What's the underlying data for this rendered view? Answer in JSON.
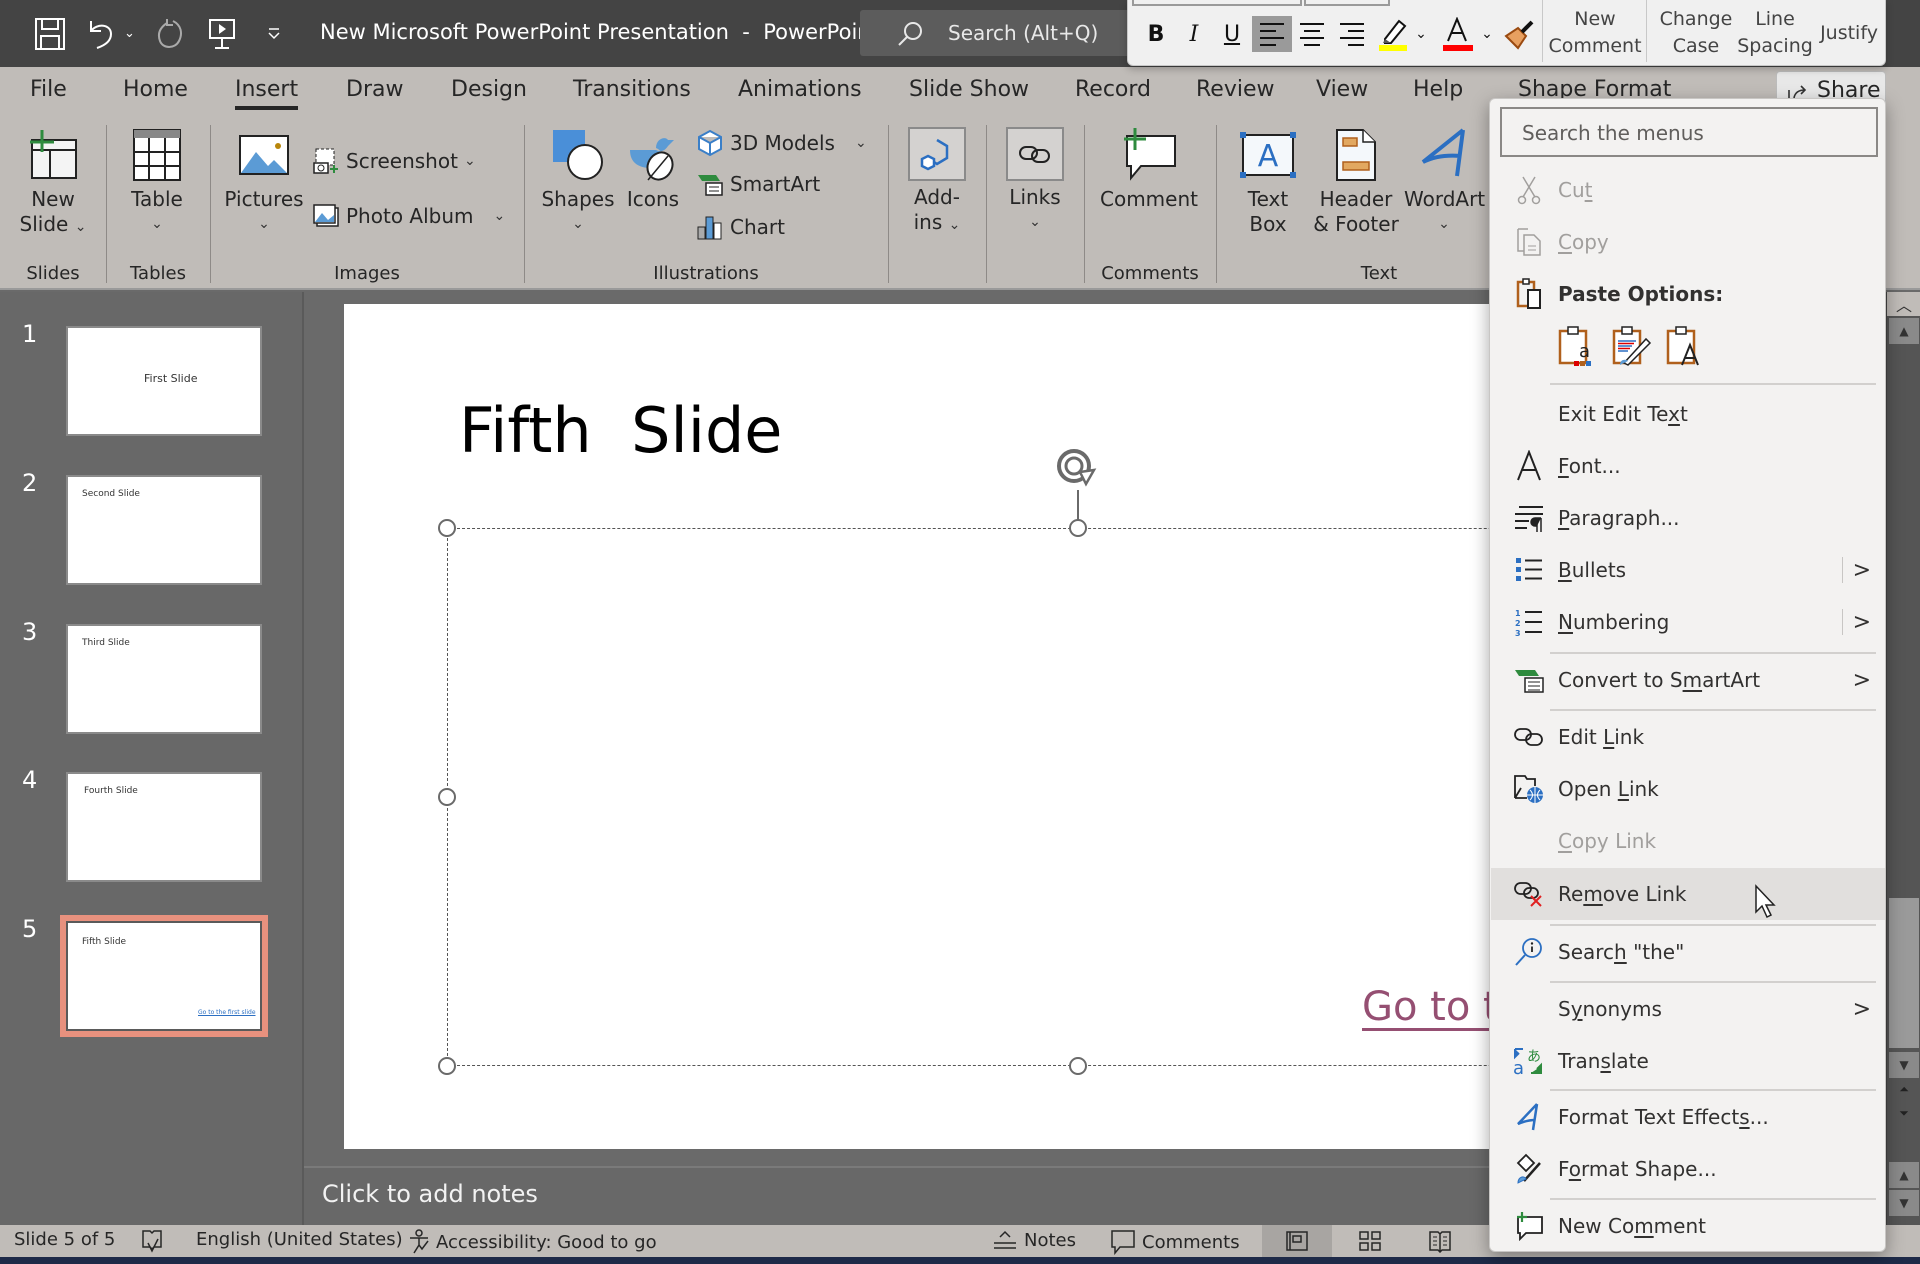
{
  "titlebar": {
    "title": "New Microsoft PowerPoint Presentation  -  PowerPoint",
    "search_placeholder": "Search (Alt+Q)",
    "qat": [
      {
        "name": "save-icon"
      },
      {
        "name": "undo-icon"
      },
      {
        "name": "redo-icon"
      },
      {
        "name": "present-from-start-icon"
      },
      {
        "name": "customize-qat-icon"
      }
    ]
  },
  "tabs": [
    {
      "label": "File",
      "active": false
    },
    {
      "label": "Home",
      "active": false
    },
    {
      "label": "Insert",
      "active": true
    },
    {
      "label": "Draw",
      "active": false
    },
    {
      "label": "Design",
      "active": false
    },
    {
      "label": "Transitions",
      "active": false
    },
    {
      "label": "Animations",
      "active": false
    },
    {
      "label": "Slide Show",
      "active": false
    },
    {
      "label": "Record",
      "active": false
    },
    {
      "label": "Review",
      "active": false
    },
    {
      "label": "View",
      "active": false
    },
    {
      "label": "Help",
      "active": false
    },
    {
      "label": "Shape Format",
      "active": false
    }
  ],
  "share_label": "Share",
  "ribbon": {
    "groups": {
      "slides": "Slides",
      "tables": "Tables",
      "images": "Images",
      "illustrations": "Illustrations",
      "comments": "Comments",
      "text": "Text"
    },
    "new_slide": [
      "New",
      "Slide"
    ],
    "table": "Table",
    "pictures": "Pictures",
    "screenshot": "Screenshot",
    "photo_album": "Photo Album",
    "shapes": "Shapes",
    "icons": "Icons",
    "models_3d": "3D Models",
    "smartart": "SmartArt",
    "chart": "Chart",
    "addins": [
      "Add-",
      "ins"
    ],
    "links": "Links",
    "comment": "Comment",
    "text_box": [
      "Text",
      "Box"
    ],
    "header_footer": [
      "Header",
      "& Footer"
    ],
    "wordart": "WordArt"
  },
  "slides": [
    {
      "num": "1",
      "title": "First Slide",
      "selected": false
    },
    {
      "num": "2",
      "title": "Second Slide",
      "selected": false
    },
    {
      "num": "3",
      "title": "Third Slide",
      "selected": false
    },
    {
      "num": "4",
      "title": "Fourth Slide",
      "selected": false
    },
    {
      "num": "5",
      "title": "Fifth  Slide",
      "selected": true,
      "link": "Go to the first slide"
    }
  ],
  "current_slide": {
    "title": "Fifth  Slide",
    "link_text_visible": "Go to t",
    "link_color": "#954f72"
  },
  "notes_placeholder": "Click to add notes",
  "status": {
    "slide_indicator": "Slide 5 of 5",
    "language": "English (United States)",
    "accessibility": "Accessibility: Good to go",
    "notes": "Notes",
    "comments": "Comments"
  },
  "mini_toolbar": {
    "bold": "B",
    "italic": "I",
    "underline": "U",
    "highlight_color": "#ffff00",
    "font_color": "#ff0000",
    "new_comment": [
      "New",
      "Comment"
    ],
    "change_case": [
      "Change",
      "Case"
    ],
    "line_spacing": [
      "Line",
      "Spacing"
    ],
    "justify": "Justify"
  },
  "context_menu": {
    "search_placeholder": "Search the menus",
    "paste_options_label": "Paste Options:",
    "items": [
      {
        "label": "Cut",
        "icon": "scissors-icon",
        "disabled": true
      },
      {
        "label": "Copy",
        "icon": "copy-icon",
        "disabled": true
      },
      {
        "label": "Exit Edit Text",
        "icon": "",
        "disabled": false
      },
      {
        "label": "Font...",
        "icon": "font-icon",
        "disabled": false
      },
      {
        "label": "Paragraph...",
        "icon": "paragraph-icon",
        "disabled": false
      },
      {
        "label": "Bullets",
        "icon": "bullets-icon",
        "disabled": false,
        "submenu": true
      },
      {
        "label": "Numbering",
        "icon": "numbering-icon",
        "disabled": false,
        "submenu": true
      },
      {
        "label": "Convert to SmartArt",
        "icon": "smartart-icon",
        "disabled": false,
        "submenu": true
      },
      {
        "label": "Edit Link",
        "icon": "link-icon",
        "disabled": false
      },
      {
        "label": "Open Link",
        "icon": "open-link-icon",
        "disabled": false
      },
      {
        "label": "Copy Link",
        "icon": "",
        "disabled": true
      },
      {
        "label": "Remove Link",
        "icon": "remove-link-icon",
        "disabled": false,
        "hover": true
      },
      {
        "label": "Search \"the\"",
        "icon": "smart-lookup-icon",
        "disabled": false
      },
      {
        "label": "Synonyms",
        "icon": "",
        "disabled": false,
        "submenu": true
      },
      {
        "label": "Translate",
        "icon": "translate-icon",
        "disabled": false
      },
      {
        "label": "Format Text Effects...",
        "icon": "text-effects-icon",
        "disabled": false
      },
      {
        "label": "Format Shape...",
        "icon": "format-shape-icon",
        "disabled": false
      },
      {
        "label": "New Comment",
        "icon": "new-comment-icon",
        "disabled": false
      }
    ]
  }
}
